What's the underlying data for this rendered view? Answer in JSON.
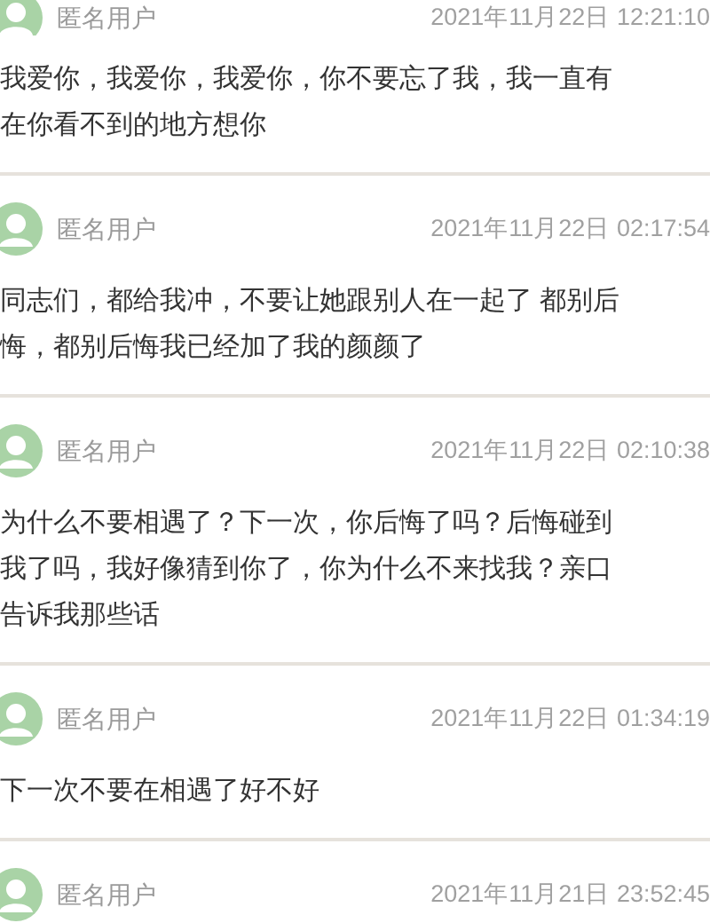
{
  "comments": [
    {
      "user": "匿名用户",
      "time": "2021年11月22日 12:21:10",
      "lines": [
        "我爱你，我爱你，我爱你，你不要忘了我，我一直有",
        "在你看不到的地方想你"
      ]
    },
    {
      "user": "匿名用户",
      "time": "2021年11月22日 02:17:54",
      "lines": [
        "同志们，都给我冲，不要让她跟别人在一起了 都别后",
        "悔，都别后悔我已经加了我的颜颜了"
      ]
    },
    {
      "user": "匿名用户",
      "time": "2021年11月22日 02:10:38",
      "lines": [
        "为什么不要相遇了？下一次，你后悔了吗？后悔碰到",
        "我了吗，我好像猜到你了，你为什么不来找我？亲口",
        "告诉我那些话"
      ]
    },
    {
      "user": "匿名用户",
      "time": "2021年11月22日 01:34:19",
      "lines": [
        "下一次不要在相遇了好不好"
      ]
    },
    {
      "user": "匿名用户",
      "time": "2021年11月21日 23:52:45"
    }
  ]
}
